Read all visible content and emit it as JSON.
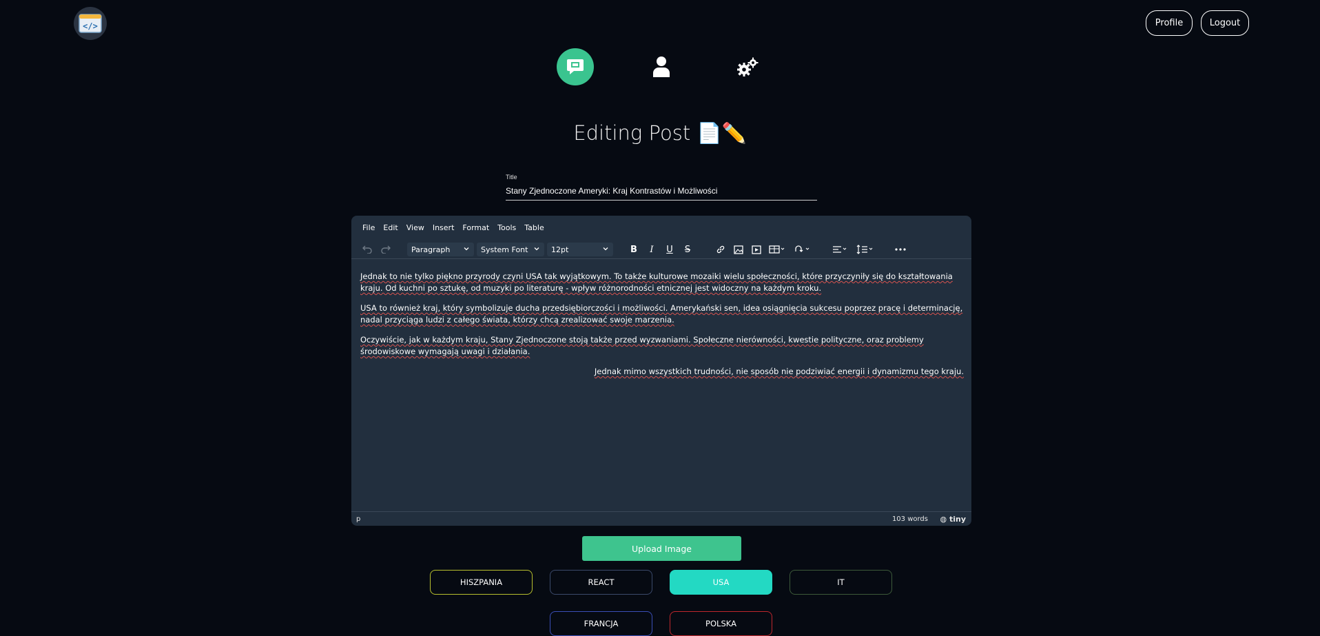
{
  "header": {
    "logo_icon": "code-window-icon",
    "profile_label": "Profile",
    "logout_label": "Logout"
  },
  "nav": {
    "items": [
      {
        "icon": "chat-post-icon",
        "active": true
      },
      {
        "icon": "user-icon",
        "active": false
      },
      {
        "icon": "gears-icon",
        "active": false
      }
    ],
    "accent_color": "#3ac48f"
  },
  "page": {
    "title": "Editing Post 📄✏️"
  },
  "form": {
    "title_label": "Title",
    "title_value": "Stany Zjednoczone Ameryki: Kraj Kontrastów i Możliwości"
  },
  "editor": {
    "menu": [
      "File",
      "Edit",
      "View",
      "Insert",
      "Format",
      "Tools",
      "Table"
    ],
    "block_format": "Paragraph",
    "font_family": "System Font",
    "font_size": "12pt",
    "paragraphs": [
      "Jednak to nie tylko piękno przyrody czyni USA tak wyjątkowym. To także kulturowe mozaiki wielu społeczności, które przyczyniły się do kształtowania kraju. Od kuchni po sztukę, od muzyki po literaturę - wpływ różnorodności etnicznej jest widoczny na każdym kroku.",
      "USA to również kraj, który symbolizuje ducha przedsiębiorczości i możliwości. Amerykański sen, idea osiągnięcia sukcesu poprzez pracę i determinację, nadal przyciąga ludzi z całego świata, którzy chcą zrealizować swoje marzenia.",
      "Oczywiście, jak w każdym kraju, Stany Zjednoczone stoją także przed wyzwaniami. Społeczne nierówności, kwestie polityczne, oraz problemy środowiskowe wymagają uwagi i działania.",
      "Jednak mimo wszystkich trudności, nie sposób nie podziwiać energii i dynamizmu tego kraju."
    ],
    "status_path": "p",
    "word_count": "103 words",
    "brand": "tiny"
  },
  "actions": {
    "upload_label": "Upload Image"
  },
  "tags": [
    {
      "label": "HISZPANIA",
      "color": "#b8c02e",
      "selected": false
    },
    {
      "label": "REACT",
      "color": "#3b4a6b",
      "selected": false
    },
    {
      "label": "USA",
      "color": "#23d9c3",
      "selected": true
    },
    {
      "label": "IT",
      "color": "#3d5a3a",
      "selected": false
    },
    {
      "label": "FRANCJA",
      "color": "#3b4fb8",
      "selected": false
    },
    {
      "label": "POLSKA",
      "color": "#c0272d",
      "selected": false
    }
  ]
}
